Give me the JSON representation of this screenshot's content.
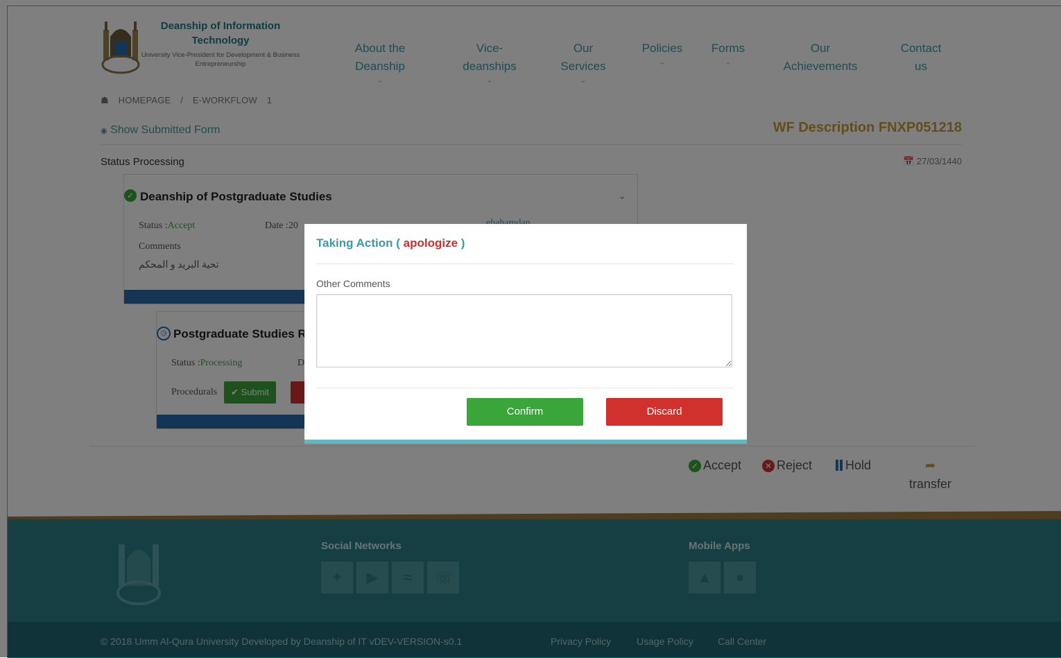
{
  "header": {
    "org_title": "Deanship of Information Technology",
    "org_subtitle": "University Vice-President for Development & Business Entrepreneurship",
    "nav": [
      {
        "label": "About the Deanship",
        "dropdown": true
      },
      {
        "label": "Vice-deanships",
        "dropdown": true
      },
      {
        "label": "Our Services",
        "dropdown": true
      },
      {
        "label": "Policies",
        "dropdown": true
      },
      {
        "label": "Forms",
        "dropdown": true
      },
      {
        "label": "Our Achievements",
        "dropdown": false
      },
      {
        "label": "Contact us",
        "dropdown": false
      }
    ]
  },
  "breadcrumb": {
    "home": "HOMEPAGE",
    "separator": "/",
    "section": "E-WORKFLOW",
    "item": "1"
  },
  "page": {
    "show_form_label": "Show Submitted Form",
    "wf_description": "WF Description FNXP051218",
    "status_label": "Status Processing",
    "date": "27/03/1440"
  },
  "cards": [
    {
      "title": "Deanship of Postgraduate Studies",
      "status_prefix": "Status :",
      "status_value": "Accept",
      "date_label": "Date :20",
      "user_fragment": "ehahamdan",
      "comments_label": "Comments",
      "comment_text": "تحية البريد و المحكم"
    },
    {
      "title": "Postgraduate Studies R",
      "status_prefix": "Status :",
      "status_value": "Processing",
      "date_fragment": "D",
      "procedurals_label": "Procedurals",
      "submit_label": "Submit"
    }
  ],
  "actions": {
    "accept": "Accept",
    "reject": "Reject",
    "hold": "Hold",
    "transfer": "transfer"
  },
  "footer": {
    "social_heading": "Social Networks",
    "social_icons": [
      "twitter-icon",
      "youtube-icon",
      "rss-icon",
      "whatsapp-icon"
    ],
    "apps_heading": "Mobile Apps",
    "app_icons": [
      "android-icon",
      "apple-icon"
    ],
    "copyright": "© 2018 Umm Al-Qura University Developed by Deanship of IT vDEV-VERSION-s0.1",
    "links": [
      "Privacy Policy",
      "Usage Policy",
      "Call Center"
    ]
  },
  "modal": {
    "title_prefix": "Taking Action (",
    "title_action": "apologize",
    "title_suffix": ")",
    "comments_label": "Other Comments",
    "comments_value": "",
    "confirm_label": "Confirm",
    "discard_label": "Discard"
  },
  "colors": {
    "teal": "#3a9aa6",
    "gold": "#c49a3a",
    "confirm_green": "#3aa53a",
    "discard_red": "#d0312d",
    "footer": "#2d7f88"
  }
}
